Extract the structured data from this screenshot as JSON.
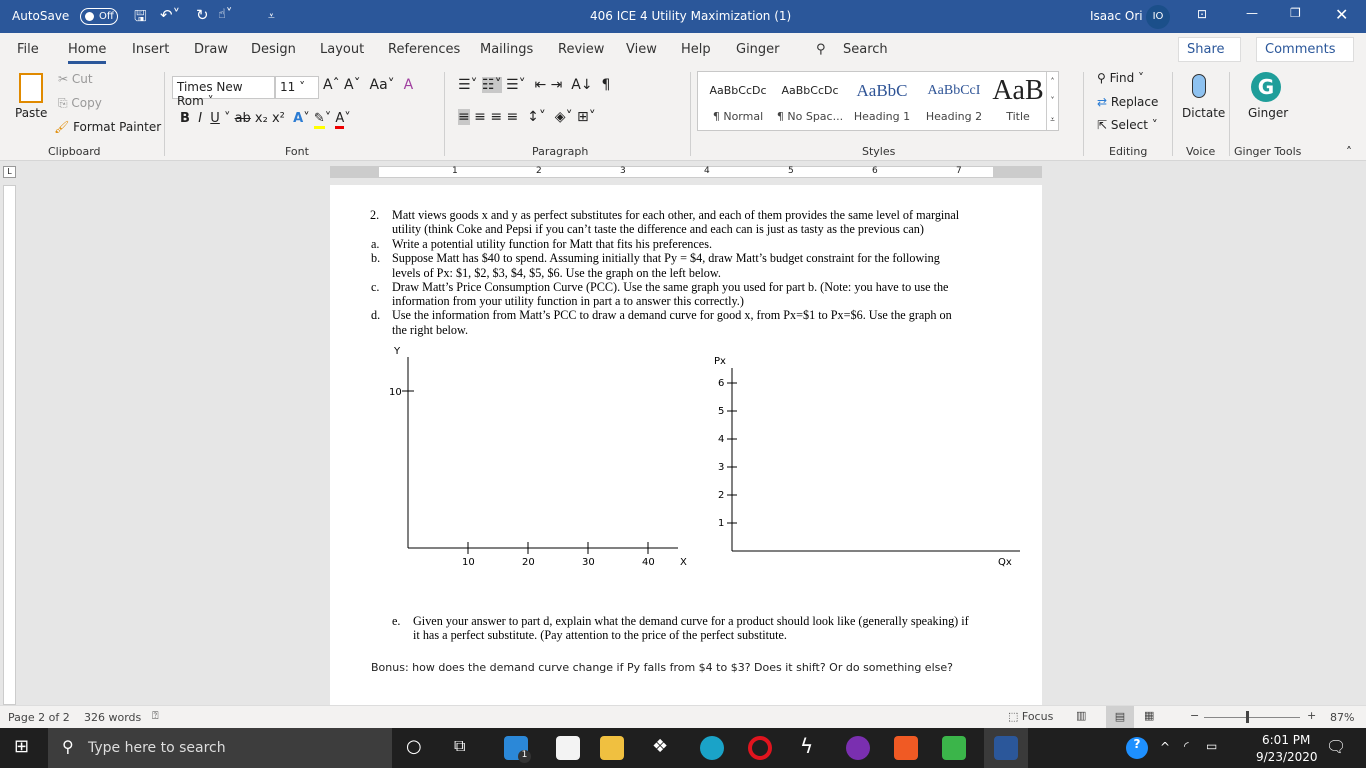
{
  "titlebar": {
    "autosave": "AutoSave",
    "autosave_state": "Off",
    "doc_title": "406 ICE 4 Utility Maximization (1)",
    "user": "Isaac Ori",
    "initials": "IO"
  },
  "tabs": [
    "File",
    "Home",
    "Insert",
    "Draw",
    "Design",
    "Layout",
    "References",
    "Mailings",
    "Review",
    "View",
    "Help",
    "Ginger"
  ],
  "search": "Search",
  "share": "Share",
  "comments": "Comments",
  "ribbon": {
    "clipboard": {
      "paste": "Paste",
      "cut": "Cut",
      "copy": "Copy",
      "format_painter": "Format Painter",
      "label": "Clipboard"
    },
    "font": {
      "name": "Times New Rom",
      "size": "11",
      "label": "Font"
    },
    "paragraph": {
      "label": "Paragraph"
    },
    "styles": {
      "label": "Styles",
      "items": [
        {
          "sample": "AaBbCcDc",
          "name": "¶ Normal"
        },
        {
          "sample": "AaBbCcDc",
          "name": "¶ No Spac..."
        },
        {
          "sample": "AaBbC",
          "name": "Heading 1"
        },
        {
          "sample": "AaBbCcI",
          "name": "Heading 2"
        },
        {
          "sample": "AaB",
          "name": "Title"
        }
      ]
    },
    "editing": {
      "find": "Find",
      "replace": "Replace",
      "select": "Select",
      "label": "Editing"
    },
    "voice": {
      "dictate": "Dictate",
      "label": "Voice"
    },
    "ginger": {
      "name": "Ginger",
      "label": "Ginger Tools"
    }
  },
  "ruler_numbers": [
    "1",
    "2",
    "3",
    "4",
    "5",
    "6",
    "7"
  ],
  "document": {
    "q2_num": "2.",
    "q2_lines": [
      "Matt views goods x and y as perfect substitutes for each other, and each of them provides the same level of marginal",
      "utility (think Coke and Pepsi if you can’t taste the difference and each can is just as tasty as the previous can)"
    ],
    "parts": [
      {
        "letter": "a.",
        "lines": [
          "Write a potential utility function for Matt that fits his preferences."
        ]
      },
      {
        "letter": "b.",
        "lines": [
          "Suppose Matt has $40 to spend. Assuming initially that Py = $4, draw Matt’s budget constraint for the following",
          "levels of Px: $1, $2, $3, $4, $5, $6. Use the graph on the left below."
        ]
      },
      {
        "letter": "c.",
        "lines": [
          "Draw Matt’s Price Consumption Curve (PCC). Use the same graph you used for part b. (Note: you have to use the",
          "information from your utility function in part a to answer this correctly.)"
        ]
      },
      {
        "letter": "d.",
        "lines": [
          "Use the information from Matt’s PCC to draw a demand curve for good x, from Px=$1 to Px=$6. Use the graph on",
          "the right below."
        ]
      }
    ],
    "part_e": {
      "letter": "e.",
      "lines": [
        "Given your answer to part d, explain what the demand curve for a product should look like (generally speaking) if",
        "it has a perfect substitute. (Pay attention to the price of the perfect substitute."
      ]
    },
    "bonus": "Bonus: how does the demand curve change if Py falls from $4 to $3? Does it shift? Or do something else?",
    "graph_left": {
      "ylabel": "Y",
      "xlabel": "X",
      "yticks": [
        "10"
      ],
      "xticks": [
        "10",
        "20",
        "30",
        "40"
      ]
    },
    "graph_right": {
      "ylabel": "Px",
      "xlabel": "Qx",
      "yticks": [
        "1",
        "2",
        "3",
        "4",
        "5",
        "6"
      ]
    }
  },
  "status": {
    "page": "Page 2 of 2",
    "words": "326 words",
    "focus": "Focus",
    "zoom": "87%",
    "zoom_level_percent": 87
  },
  "taskbar": {
    "search_placeholder": "Type here to search",
    "time": "6:01 PM",
    "date": "9/23/2020",
    "mail_badge": "1",
    "notif_badge": "1"
  }
}
